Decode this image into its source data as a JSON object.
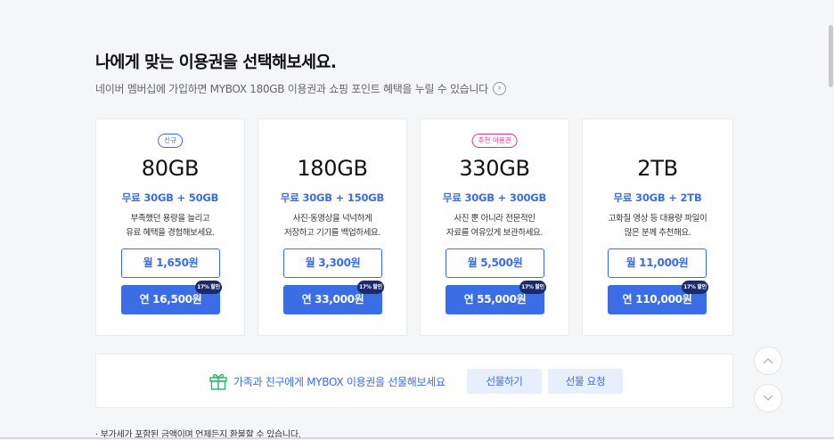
{
  "header": {
    "title": "나에게 맞는 이용권을 선택해보세요.",
    "subtitle": "네이버 멤버십에 가입하면 MYBOX 180GB 이용권과 쇼핑 포인트 혜택을 누릴 수 있습니다",
    "subtitle_arrow": "›"
  },
  "plans": [
    {
      "badge": "신규",
      "badge_type": "new",
      "size": "80GB",
      "free": "무료 30GB + 50GB",
      "desc1": "부족했던 용량을 늘리고",
      "desc2": "유료 혜택을 경험해보세요.",
      "monthly": "월 1,650원",
      "yearly": "연 16,500원",
      "discount": "17% 할인"
    },
    {
      "badge": "",
      "badge_type": "",
      "size": "180GB",
      "free": "무료 30GB + 150GB",
      "desc1": "사진·동영상을 넉넉하게",
      "desc2": "저장하고 기기를 백업하세요.",
      "monthly": "월 3,300원",
      "yearly": "연 33,000원",
      "discount": "17% 할인"
    },
    {
      "badge": "추천 이용권",
      "badge_type": "rec",
      "size": "330GB",
      "free": "무료 30GB + 300GB",
      "desc1": "사진 뿐 아니라 전문적인",
      "desc2": "자료를 여유있게 보관하세요.",
      "monthly": "월 5,500원",
      "yearly": "연 55,000원",
      "discount": "17% 할인"
    },
    {
      "badge": "",
      "badge_type": "",
      "size": "2TB",
      "free": "무료 30GB + 2TB",
      "desc1": "고화질 영상 등 대용량 파일이",
      "desc2": "많은 분께 추천해요.",
      "monthly": "월 11,000원",
      "yearly": "연 110,000원",
      "discount": "17% 할인"
    }
  ],
  "gift": {
    "icon": "gift-icon",
    "text": "가족과 친구에게 MYBOX 이용권을 선물해보세요",
    "send_label": "선물하기",
    "request_label": "선물 요청"
  },
  "notice": "· 부가세가 포함된 금액이며 언제든지 환불할 수 있습니다.",
  "colors": {
    "accent": "#3b6ee5",
    "recommend": "#e5308a",
    "discount_badge": "#1b2a6b"
  }
}
